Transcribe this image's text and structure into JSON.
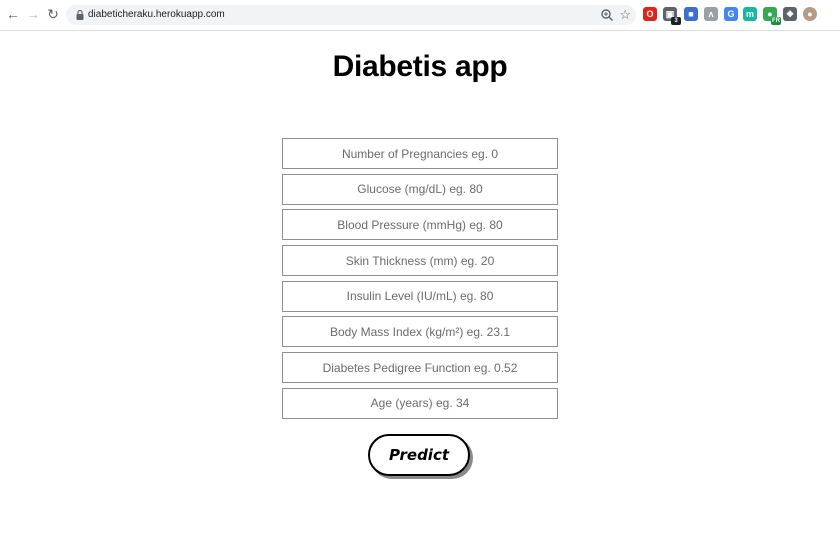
{
  "browser": {
    "url": "diabeticheraku.herokuapp.com",
    "extensions": [
      {
        "name": "opera-icon",
        "color": "#e2231a",
        "glyph": "O"
      },
      {
        "name": "extension-badge-icon",
        "color": "#5f6368",
        "glyph": "▣",
        "badge": "3"
      },
      {
        "name": "translate-ext-icon",
        "color": "#3c6fd1",
        "glyph": "■"
      },
      {
        "name": "arrow-ext-icon",
        "color": "#9aa0a6",
        "glyph": "ʌ"
      },
      {
        "name": "google-translate-icon",
        "color": "#4285f4",
        "glyph": "G"
      },
      {
        "name": "m-ext-icon",
        "color": "#1bb5a3",
        "glyph": "m"
      },
      {
        "name": "fr-ext-icon",
        "color": "#34a853",
        "glyph": "●",
        "badge": "FR"
      },
      {
        "name": "puzzle-icon",
        "color": "#5f6368",
        "glyph": "❖"
      },
      {
        "name": "avatar",
        "color": "#b59a84",
        "glyph": "●"
      }
    ]
  },
  "page": {
    "title": "Diabetis app"
  },
  "form": {
    "fields": [
      {
        "placeholder": "Number of Pregnancies eg. 0",
        "value": ""
      },
      {
        "placeholder": "Glucose (mg/dL) eg. 80",
        "value": ""
      },
      {
        "placeholder": "Blood Pressure (mmHg) eg. 80",
        "value": ""
      },
      {
        "placeholder": "Skin Thickness (mm) eg. 20",
        "value": ""
      },
      {
        "placeholder": "Insulin Level (IU/mL) eg. 80",
        "value": ""
      },
      {
        "placeholder": "Body Mass Index (kg/m²) eg. 23.1",
        "value": ""
      },
      {
        "placeholder": "Diabetes Pedigree Function eg. 0.52",
        "value": ""
      },
      {
        "placeholder": "Age (years) eg. 34",
        "value": ""
      }
    ],
    "submit_label": "Predict"
  }
}
